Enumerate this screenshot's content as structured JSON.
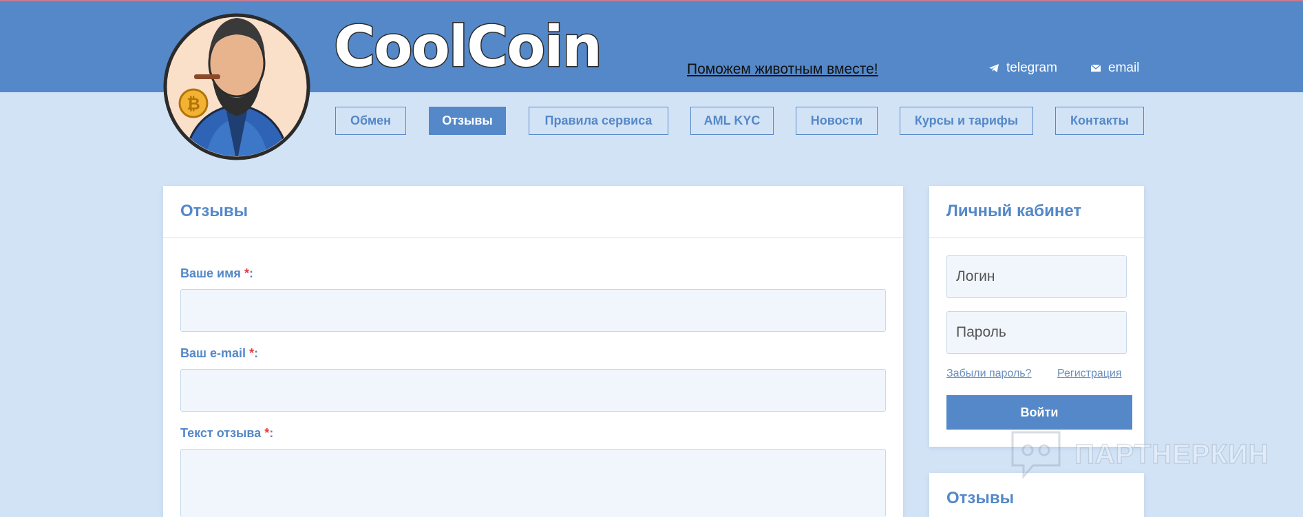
{
  "header": {
    "logo_text": "CoolCoin",
    "promo_link": "Поможем животным вместе!",
    "contacts": [
      {
        "label": "telegram",
        "icon": "telegram-icon"
      },
      {
        "label": "email",
        "icon": "mail-icon"
      }
    ]
  },
  "nav": [
    {
      "label": "Обмен",
      "active": false
    },
    {
      "label": "Отзывы",
      "active": true
    },
    {
      "label": "Правила сервиса",
      "active": false
    },
    {
      "label": "AML KYC",
      "active": false
    },
    {
      "label": "Новости",
      "active": false
    },
    {
      "label": "Курсы и тарифы",
      "active": false
    },
    {
      "label": "Контакты",
      "active": false
    }
  ],
  "reviews_form": {
    "title": "Отзывы",
    "name_label": "Ваше имя",
    "email_label": "Ваш e-mail",
    "text_label": "Текст отзыва",
    "required_mark": "*",
    "colon": ":"
  },
  "account": {
    "title": "Личный кабинет",
    "login_placeholder": "Логин",
    "password_placeholder": "Пароль",
    "forgot_link": "Забыли пароль?",
    "register_link": "Регистрация",
    "login_button": "Войти"
  },
  "reviews_widget": {
    "title": "Отзывы"
  },
  "watermark": {
    "text": "ПАРТНЕРКИН"
  },
  "colors": {
    "header_bg": "#5488c8",
    "page_bg": "#d3e3f6",
    "accent": "#5488c8",
    "required": "#e5383b"
  }
}
